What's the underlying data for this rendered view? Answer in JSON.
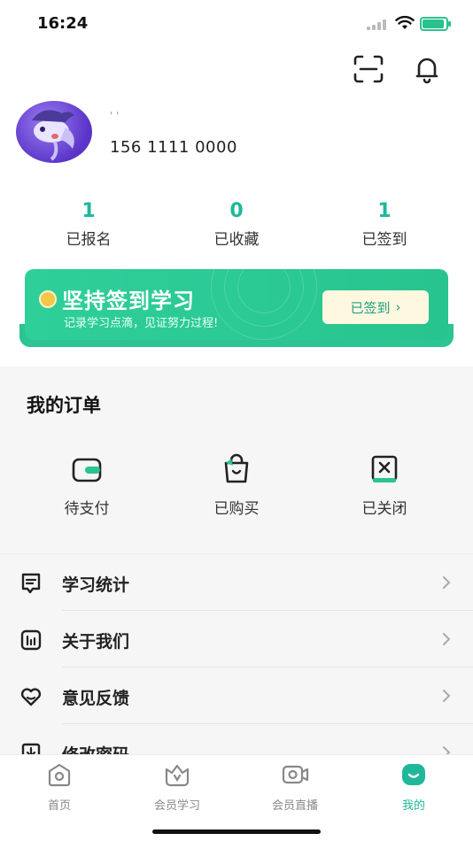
{
  "status_bar": {
    "time": "16:24"
  },
  "profile": {
    "nickname": "' '",
    "phone": "156 1111 0000"
  },
  "stats": [
    {
      "value": "1",
      "label": "已报名"
    },
    {
      "value": "0",
      "label": "已收藏"
    },
    {
      "value": "1",
      "label": "已签到"
    }
  ],
  "banner": {
    "title": "坚持签到学习",
    "subtitle": "记录学习点滴，见证努力过程!",
    "button_label": "已签到",
    "button_chevron": "›"
  },
  "orders": {
    "title": "我的订单",
    "items": [
      {
        "label": "待支付",
        "icon": "wallet-icon"
      },
      {
        "label": "已购买",
        "icon": "shopping-bag-icon"
      },
      {
        "label": "已关闭",
        "icon": "closed-order-icon"
      }
    ]
  },
  "menu": [
    {
      "label": "学习统计",
      "icon": "study-stats-icon"
    },
    {
      "label": "关于我们",
      "icon": "about-us-icon"
    },
    {
      "label": "意见反馈",
      "icon": "feedback-heart-icon"
    },
    {
      "label": "修改密码",
      "icon": "change-password-icon"
    }
  ],
  "tabbar": [
    {
      "label": "首页",
      "icon": "home-icon",
      "active": false
    },
    {
      "label": "会员学习",
      "icon": "member-study-icon",
      "active": false
    },
    {
      "label": "会员直播",
      "icon": "live-camera-icon",
      "active": false
    },
    {
      "label": "我的",
      "icon": "mine-icon",
      "active": true
    }
  ],
  "colors": {
    "accent": "#1fb89a",
    "banner": "#2bc492",
    "button_bg": "#fff8e1"
  }
}
